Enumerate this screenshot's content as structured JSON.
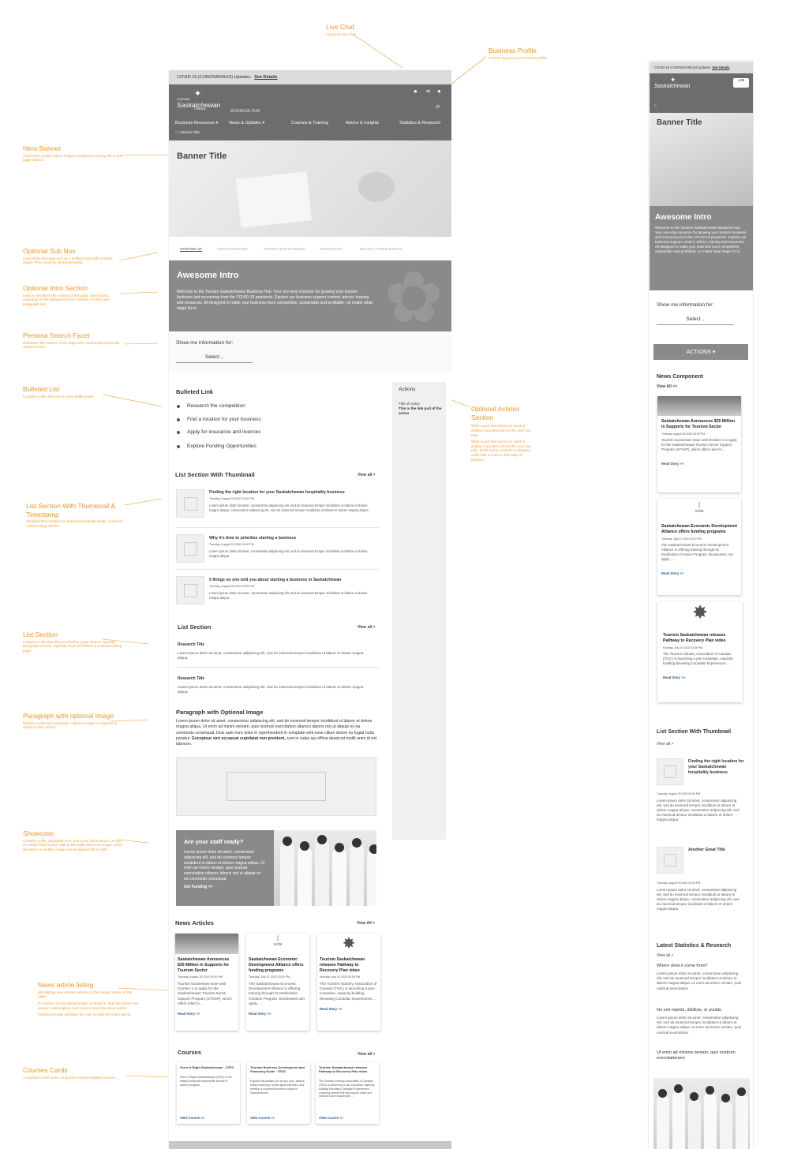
{
  "annotations": {
    "live_chat": {
      "title": "Live Chat",
      "desc": "Launches live chat"
    },
    "business_profile": {
      "title": "Business Profile",
      "desc": "Used to log into your business profile"
    },
    "hero_banner": {
      "title": "Hero Banner",
      "desc": "Used when a high impact image is employed to bring life to the page subject"
    },
    "optional_sub_nav": {
      "title": "Optional Sub Nav",
      "desc": "Used when the page acts as a unified portal with multiple pages. This would be sticky/anchored."
    },
    "optional_intro": {
      "title": "Optional Intro Section",
      "desc": "Used to introduce the content of the page. Uses brand colouring on the background and consists of a title and paragraph text."
    },
    "persona_search": {
      "title": "Persona Search Facet",
      "desc": "Refreshes the content of the page with content relevant to the visitor's sector"
    },
    "bulleted_list": {
      "title": "Bulleted List",
      "desc": "Contains a title and one to many bullet points"
    },
    "list_thumb": {
      "title": "List Section With Thumbnail & Timestamp",
      "desc": "Variation that contains an optional thumbnail image. Could be used for blog articles."
    },
    "list_section": {
      "title": "List Section",
      "desc": "Contains a title that links to a further page, and an optional paragraph section. Optional 'View All' if there is a deeper listing page."
    },
    "paragraph": {
      "title": "Paragraph with optional Image",
      "desc": "Delivers a title and paragraph. Optional image or diagram to reinforce the content"
    },
    "showcase": {
      "title": "Showcase",
      "desc": "Contains a title, paragraph text, and a text call to action on top of a solid brand colour. Half of the width will be an image, which will stack on mobile. Image can be aligned left or right."
    },
    "actions_title": {
      "title": "Optional Actions Section"
    },
    "actions_desc1": "When used, this section is used to display important actions the user can take.",
    "actions_desc2": "When used, this section is used to display important actions the user can take. Each action contains a category, a title that is a link to the page or function.",
    "news_listing": {
      "title": "News article listing",
      "desc1": "Will display new articles relevant to the subject matter of the page.",
      "desc2": "It consists of a thumbnail image, a headline, date the article was posted, a description, and a link to read the entire article.",
      "desc3": "Clicking through will allow the user to read the entire article."
    },
    "courses_cards": {
      "title": "Courses Cards",
      "desc": "A variation of the news component used to display courses"
    }
  },
  "desktop": {
    "covid": "COVID-19 (CORONAVIRUS) Updates:",
    "covid_link": "See Details",
    "logo_small": "TOURISM",
    "logo": "Saskatchewan",
    "logo_canada": "CANADA",
    "business_hub": "BUSINESS HUB",
    "nav": [
      "Business Resources ▾",
      "News & Updates ▾",
      "Courses & Training",
      "Advice & Insights",
      "Statistics & Research"
    ],
    "breadcrumb": "Section Title",
    "banner_title": "Banner Title",
    "subnav": [
      "STARTING UP",
      "STOP STAGNATING",
      "EXPAND YOUR BUSINESS",
      "DIVERSIFYING",
      "SELLING YOUR BUSINESS"
    ],
    "intro_title": "Awesome Intro",
    "intro_text": "Welcome to the Tourism Saskatchewan Business Hub. Your one-stop resource for growing your tourism business and recovering from the COVID-19 pandemic. Explore our business support content, advice, training and resources. All designed to make your business more competitive, sustainable and profitable, no matter what stage it's in.",
    "show_me": "Show me information for:",
    "select": "Select",
    "bulleted_title": "Bulleted Link",
    "bullets": [
      "Research the competition",
      "Find a location for your business",
      "Apply for insurance and licences",
      "Explore Funding Opportunities"
    ],
    "actions_title": "Actions",
    "actions_cat": "Title of Action",
    "actions_link": "This is the link part of the action",
    "list_thumb_title": "List Section With Thumbnail",
    "view_all": "View all >",
    "list_thumb_items": [
      {
        "title": "Finding the right location for your Saskatchewan hospitality business",
        "date": "Tuesday, August 25 2020 03:00 PM",
        "text": "Lorem ipsum dolor sit amet, consectetur adipiscing elit, sed do eiusmod tempor incididunt ut labore et dolore magna aliqua. consectetur adipiscing elit, sed do eiusmod tempor incididunt ut labore et dolore magna aliqua."
      },
      {
        "title": "Why it's time to prioritize starting a business",
        "date": "Tuesday, August 25 2020 03:00 PM",
        "text": "Lorem ipsum dolor sit amet, consectetur adipiscing elit, sed do eiusmod tempor incididunt ut labore et dolore magna aliqua."
      },
      {
        "title": "5 things no one told you about starting a business in Saskatchewan",
        "date": "Tuesday, August 25 2020 03:00 PM",
        "text": "Lorem ipsum dolor sit amet, consectetur adipiscing elit, sed do eiusmod tempor incididunt ut labore et dolore magna aliqua."
      }
    ],
    "list_title": "List Section",
    "list_items": [
      {
        "title": "Research Title",
        "text": "Lorem ipsum dolor sit amet, consectetur adipiscing elit, sed do eiusmod tempor incididunt ut labore et dolore magna aliqua."
      },
      {
        "title": "Research Title",
        "text": "Lorem ipsum dolor sit amet, consectetur adipiscing elit, sed do eiusmod tempor incididunt ut labore et dolore magna aliqua."
      }
    ],
    "para_title": "Paragraph with Optional Image",
    "para_text": "Lorem ipsum dolor sit amet, consectetur adipiscing elit, sed do eiusmod tempor incididunt ut labore et dolore magna aliqua. Ut enim ad minim veniam, quis nostrud exercitation ullamco laboris nisi ut aliquip ex ea commodo consequat. Duis aute irure dolor in reprehenderit in voluptate velit esse cillum dolore eu fugiat nulla pariatur.",
    "para_bold": "Excepteur sint occaecat cupidatat non proident,",
    "para_tail": "sunt in culpa qui officia deserunt mollit anim id est laborum.",
    "show_title": "Are your staff ready?",
    "show_text": "Lorem ipsum dolor sit amet, consectetur adipiscing elit, sed do eiusmod tempor incididunt ut labore et dolore magna aliqua. Ut enim ad minim veniam, quis nostrud exercitation ullamco laboris nisi ut aliquip ex ea commodo consequat.",
    "show_link": "Get Funding >>",
    "news_title": "News Articles",
    "news_view": "View All >",
    "news": [
      {
        "title": "Saskatchewan Announces $35 Million in Supports for Tourism Sector",
        "date": "Tuesday, August 25 2020 03:00 PM",
        "text": "Tourism businesses have until October 1 to apply for the Saskatchewan Tourism Sector Support Program (STSSP), which offers relief to ...",
        "link": "Read Story >>"
      },
      {
        "title": "Saskatchewan Economic Development Alliance offers funding programs",
        "date": "Tuesday, July 21 2020 03:00 PM",
        "text": "The Saskatchewan Economic Development Alliance is offering training through its Destination Creation Program. Businesses can apply ....",
        "link": "Read Story >>"
      },
      {
        "title": "Tourism Saskatchewan releases Pathway to Recovery Plan video",
        "date": "Monday, July 20 2020 03:58 PM",
        "text": "The Tourism Industry Association of Canada (TIAC) is launching a pan-Canadian, capacity-building Elevating Canadian Experiences ...",
        "link": "Read Story >>"
      }
    ],
    "seda": "seda",
    "courses_title": "Courses",
    "courses_view": "View all >",
    "courses": [
      {
        "title": "Serve It Right Saskatchewan - STEC",
        "text": "Serve It Right Saskatchewan (SIRS) is the official provincial responsible service of alcohol program.",
        "link": "View Course >>"
      },
      {
        "title": "Tourism Business Development and Financing Guide · STEC",
        "text": "A guide that assists you as you plan, assess, obtain financing, review approvals/fees, and develop a successful tourism project in Saskatchewan.",
        "link": "View Course >>"
      },
      {
        "title": "Tourism Saskatchewan releases Pathway to Recovery Plan video",
        "text": "The Tourism Industry Association of Canada (TIAC) is launching a pan-Canadian, capacity-building Elevating Canadian Experiences coaching stream that will support small and medium sized businesses ...",
        "link": "View Course >>"
      }
    ]
  },
  "mobile": {
    "covid": "COVID-19 (CORONAVIRUS) Updates:",
    "covid_link": "See Details",
    "banner_title": "Banner Title",
    "intro_title": "Awesome Intro",
    "intro_text": "Welcome to the Tourism Saskatchewan Business Hub. Your one-stop resource for growing your tourism business and recovering from the COVID-19 pandemic. Explore our business support content, advice, training and resources. All designed to make your business more competitive, sustainable and profitable, no matter what stage it's in.",
    "show_me": "Show me information for:",
    "select": "Select",
    "actions": "ACTIONS ▾",
    "news_title": "News Component",
    "news_view": "View All >>",
    "news": [
      {
        "title": "Saskatchewan Announces $35 Million in Supports for Tourism Sector",
        "date": "Tuesday, August 25 2020 03:00 PM",
        "text": "Tourism businesses have until October 1 to apply for the Saskatchewan Tourism Sector Support Program (STSSP), which offers relief to ...",
        "link": "Read Story >>"
      },
      {
        "title": "Saskatchewan Economic Development Alliance offers funding programs",
        "date": "Tuesday, July 21 2020 03:00 PM",
        "text": "The Saskatchewan Economic Development Alliance is offering training through its Destination Creation Program. Businesses can apply ....",
        "link": "Read Story >>"
      },
      {
        "title": "Tourism Saskatchewan releases Pathway to Recovery Plan video",
        "date": "Monday, July 20 2020 03:58 PM",
        "text": "The Tourism Industry Association of Canada (TIAC) is launching a pan-Canadian, capacity-building Elevating Canadian Experiences ...",
        "link": "Read Story >>"
      }
    ],
    "list_title": "List Section With Thumbnail",
    "list_view": "View all >",
    "list": [
      {
        "title": "Finding the right location for your Saskatchewan hospitality business",
        "date": "Tuesday, August 25 2020 03:00 PM",
        "text": "Lorem ipsum dolor sit amet, consectetur adipiscing elit, sed do eiusmod tempor incididunt ut labore et dolore magna aliqua. consectetur adipiscing elit, sed do eiusmod tempor incididunt ut labore et dolore magna aliqua."
      },
      {
        "title": "Another Great Title",
        "date": "Tuesday, August 25 2020 03:00 PM",
        "text": "Lorem ipsum dolor sit amet, consectetur adipiscing elit, sed do eiusmod tempor incididunt ut labore et dolore magna aliqua. consectetur adipiscing elit, sed do eiusmod tempor incididunt ut labore et dolore magna aliqua."
      }
    ],
    "stats_title": "Latest Statistics & Research",
    "stats_view": "View all >",
    "stats": [
      {
        "title": "Where does it come from?",
        "text": "Lorem ipsum dolor sit amet, consectetur adipiscing elit, sed do eiusmod tempor incididunt ut labore et dolore magna aliqua. Ut enim ad minim veniam, quis nostrud exercitation"
      },
      {
        "title": "No one rejects, dislikes, or avoids",
        "text": "Lorem ipsum dolor sit amet, consectetur adipiscing elit, sed do eiusmod tempor incididunt ut labore et dolore magna aliqua. Ut enim ad minim veniam, quis nostrud exercitation"
      }
    ],
    "stats_last": "Ut enim ad minima veniam, quis nostrum exercitationem"
  },
  "colors": {
    "accent": "#f7941d",
    "header": "#6d6d6d",
    "intro": "#8a8a8a",
    "link": "#2c5a8a"
  }
}
